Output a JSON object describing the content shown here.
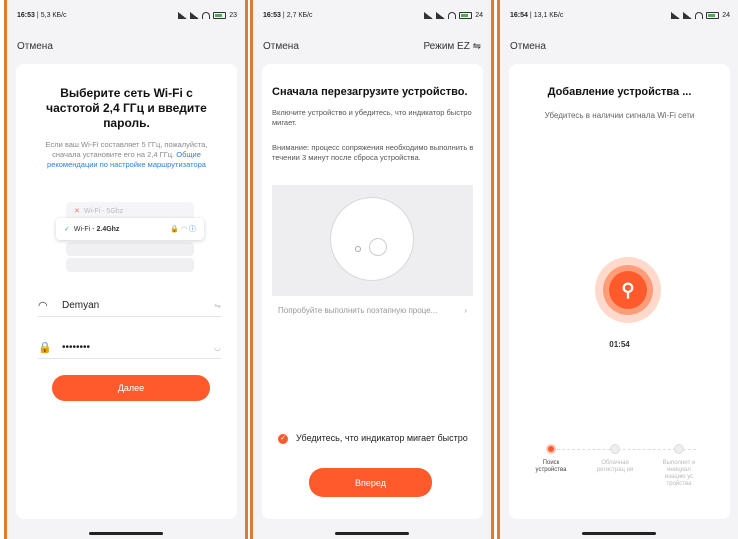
{
  "colors": {
    "accent": "#ff5a2c",
    "link": "#2f7fd8",
    "frame": "#e07a2e"
  },
  "screens": [
    {
      "status": {
        "time": "16:53",
        "speed": "5,3 КБ/с",
        "battery": "23"
      },
      "nav": {
        "cancel": "Отмена"
      },
      "title": "Выберите сеть Wi-Fi с частотой 2,4 ГГц и введите пароль.",
      "desc": "Если ваш Wi-Fi составляет 5 ГГц, пожалуйста, сначала установите его на 2,4 ГГц.",
      "desc_link": "Общие рекомендации по настройке маршрутизатора",
      "wifi_bad": "Wi-Fi - 5Ghz",
      "wifi_good_prefix": "Wi-Fi - ",
      "wifi_good_band": "2.4Ghz",
      "ssid": "Demyan",
      "password": "••••••••",
      "next_button": "Далее"
    },
    {
      "status": {
        "time": "16:53",
        "speed": "2,7 КБ/с",
        "battery": "24"
      },
      "nav": {
        "cancel": "Отмена",
        "mode": "Режим EZ ⇋"
      },
      "title": "Сначала перезагрузите устройство.",
      "text1": "Включите устройство и убедитесь, что индикатор быстро мигает.",
      "text2": "Внимание: процесс сопряжения необходимо выполнить в течении 3 минут после сброса устройства.",
      "try_link": "Попробуйте выполнить поэтапную проце...",
      "confirm": "Убедитесь, что индикатор мигает быстро",
      "next_button": "Вперед"
    },
    {
      "status": {
        "time": "16:54",
        "speed": "13,1 КБ/с",
        "battery": "24"
      },
      "nav": {
        "cancel": "Отмена"
      },
      "title": "Добавление устройства ...",
      "subtitle": "Убедитесь в наличии сигнала Wi-Fi сети",
      "timer": "01:54",
      "steps": [
        "Поиск устройства",
        "Облачная регистрац ия",
        "Выполнит е инициал изацию ус тройства"
      ]
    }
  ]
}
